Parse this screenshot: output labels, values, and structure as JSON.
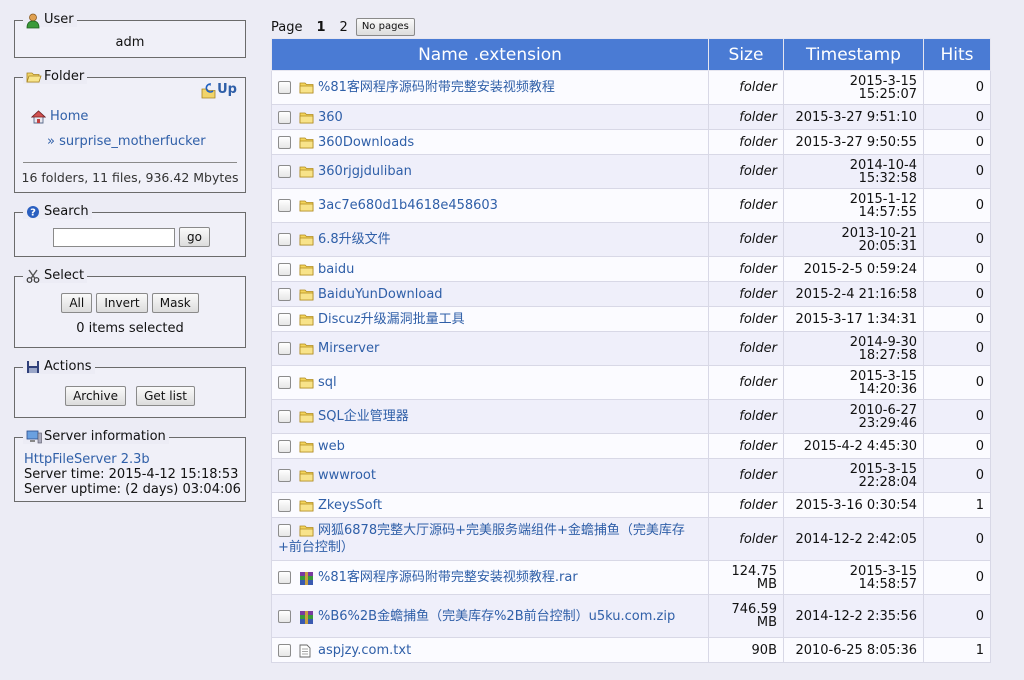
{
  "sidebar": {
    "user": {
      "title": "User",
      "name": "adm"
    },
    "folder": {
      "title": "Folder",
      "up_label": "Up",
      "home_label": "Home",
      "current_folder": "» surprise_motherfucker",
      "summary": "16 folders, 11 files, 936.42 Mbytes"
    },
    "search": {
      "title": "Search",
      "value": "",
      "go_label": "go"
    },
    "select": {
      "title": "Select",
      "all_label": "All",
      "invert_label": "Invert",
      "mask_label": "Mask",
      "status": "0 items selected"
    },
    "actions": {
      "title": "Actions",
      "archive_label": "Archive",
      "getlist_label": "Get list"
    },
    "server": {
      "title": "Server information",
      "software_link": "HttpFileServer 2.3b",
      "time": "Server time: 2015-4-12 15:18:53",
      "uptime": "Server uptime: (2 days) 03:04:06"
    }
  },
  "pager": {
    "label": "Page",
    "current": "1",
    "next": "2",
    "nopages_label": "No pages"
  },
  "table": {
    "headers": {
      "name": "Name .extension",
      "size": "Size",
      "timestamp": "Timestamp",
      "hits": "Hits"
    },
    "rows": [
      {
        "type": "folder",
        "name": "%81客网程序源码附带完整安装视频教程",
        "size": "folder",
        "timestamp": "2015-3-15\n15:25:07",
        "hits": "0"
      },
      {
        "type": "folder",
        "name": "360",
        "size": "folder",
        "timestamp": "2015-3-27 9:51:10",
        "hits": "0"
      },
      {
        "type": "folder",
        "name": "360Downloads",
        "size": "folder",
        "timestamp": "2015-3-27 9:50:55",
        "hits": "0"
      },
      {
        "type": "folder",
        "name": "360rjgjduliban",
        "size": "folder",
        "timestamp": "2014-10-4\n15:32:58",
        "hits": "0"
      },
      {
        "type": "folder",
        "name": "3ac7e680d1b4618e458603",
        "size": "folder",
        "timestamp": "2015-1-12\n14:57:55",
        "hits": "0"
      },
      {
        "type": "folder",
        "name": "6.8升级文件",
        "size": "folder",
        "timestamp": "2013-10-21\n20:05:31",
        "hits": "0"
      },
      {
        "type": "folder",
        "name": "baidu",
        "size": "folder",
        "timestamp": "2015-2-5 0:59:24",
        "hits": "0"
      },
      {
        "type": "folder",
        "name": "BaiduYunDownload",
        "size": "folder",
        "timestamp": "2015-2-4 21:16:58",
        "hits": "0"
      },
      {
        "type": "folder",
        "name": "Discuz升级漏洞批量工具",
        "size": "folder",
        "timestamp": "2015-3-17 1:34:31",
        "hits": "0"
      },
      {
        "type": "folder",
        "name": "Mirserver",
        "size": "folder",
        "timestamp": "2014-9-30\n18:27:58",
        "hits": "0"
      },
      {
        "type": "folder",
        "name": "sql",
        "size": "folder",
        "timestamp": "2015-3-15\n14:20:36",
        "hits": "0"
      },
      {
        "type": "folder",
        "name": "SQL企业管理器",
        "size": "folder",
        "timestamp": "2010-6-27\n23:29:46",
        "hits": "0"
      },
      {
        "type": "folder",
        "name": "web",
        "size": "folder",
        "timestamp": "2015-4-2 4:45:30",
        "hits": "0"
      },
      {
        "type": "folder",
        "name": "wwwroot",
        "size": "folder",
        "timestamp": "2015-3-15\n22:28:04",
        "hits": "0"
      },
      {
        "type": "folder",
        "name": "ZkeysSoft",
        "size": "folder",
        "timestamp": "2015-3-16 0:30:54",
        "hits": "1"
      },
      {
        "type": "folder",
        "name": "网狐6878完整大厅源码+完美服务端组件+金蟾捕鱼（完美库存+前台控制）",
        "size": "folder",
        "timestamp": "2014-12-2 2:42:05",
        "hits": "0"
      },
      {
        "type": "archive",
        "name": "%81客网程序源码附带完整安装视频教程.rar",
        "size": "124.75\nMB",
        "timestamp": "2015-3-15\n14:58:57",
        "hits": "0"
      },
      {
        "type": "archive",
        "name": "%B6%2B金蟾捕鱼（完美库存%2B前台控制）u5ku.com.zip",
        "size": "746.59\nMB",
        "timestamp": "2014-12-2 2:35:56",
        "hits": "0"
      },
      {
        "type": "text",
        "name": "aspjzy.com.txt",
        "size": "90B",
        "timestamp": "2010-6-25 8:05:36",
        "hits": "1"
      }
    ]
  },
  "colors": {
    "header_bg": "#4a7bd4",
    "link": "#2f5fa8",
    "page_bg": "#ececf5"
  }
}
